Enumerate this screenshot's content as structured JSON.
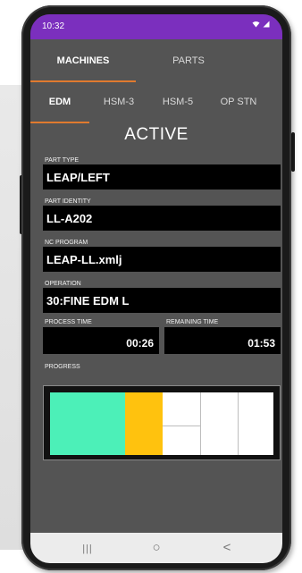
{
  "status_bar": {
    "time": "10:32",
    "background_color": "#7b2fbe",
    "icons": [
      "wifi-icon",
      "signal-icon"
    ]
  },
  "top_tabs": [
    {
      "label": "MACHINES",
      "active": true
    },
    {
      "label": "PARTS",
      "active": false
    }
  ],
  "sub_tabs": [
    {
      "label": "EDM",
      "active": true
    },
    {
      "label": "HSM-3",
      "active": false
    },
    {
      "label": "HSM-5",
      "active": false
    },
    {
      "label": "OP STN",
      "active": false
    }
  ],
  "state_title": "ACTIVE",
  "fields": {
    "part_type": {
      "label": "PART TYPE",
      "value": "LEAP/LEFT"
    },
    "part_identity": {
      "label": "PART IDENTITY",
      "value": "LL-A202"
    },
    "nc_program": {
      "label": "NC PROGRAM",
      "value": "LEAP-LL.xmlj"
    },
    "operation": {
      "label": "OPERATION",
      "value": "30:FINE EDM L"
    }
  },
  "times": {
    "process": {
      "label": "PROCESS TIME",
      "value": "00:26"
    },
    "remaining": {
      "label": "REMAINING TIME",
      "value": "01:53"
    }
  },
  "progress": {
    "label": "PROGRESS",
    "segments": [
      {
        "state": "done",
        "color": "#4cf0b8"
      },
      {
        "state": "done",
        "color": "#4cf0b8"
      },
      {
        "state": "in-progress",
        "color": "#ffc20e"
      },
      {
        "state": "pending",
        "color": "#ffffff"
      },
      {
        "state": "pending",
        "color": "#ffffff"
      },
      {
        "state": "pending",
        "color": "#ffffff"
      }
    ]
  },
  "nav_bar": {
    "recents": "|||",
    "home": "○",
    "back": "<"
  },
  "colors": {
    "accent": "#e07a2f",
    "screen_bg": "#545454",
    "field_bg": "#000000"
  }
}
